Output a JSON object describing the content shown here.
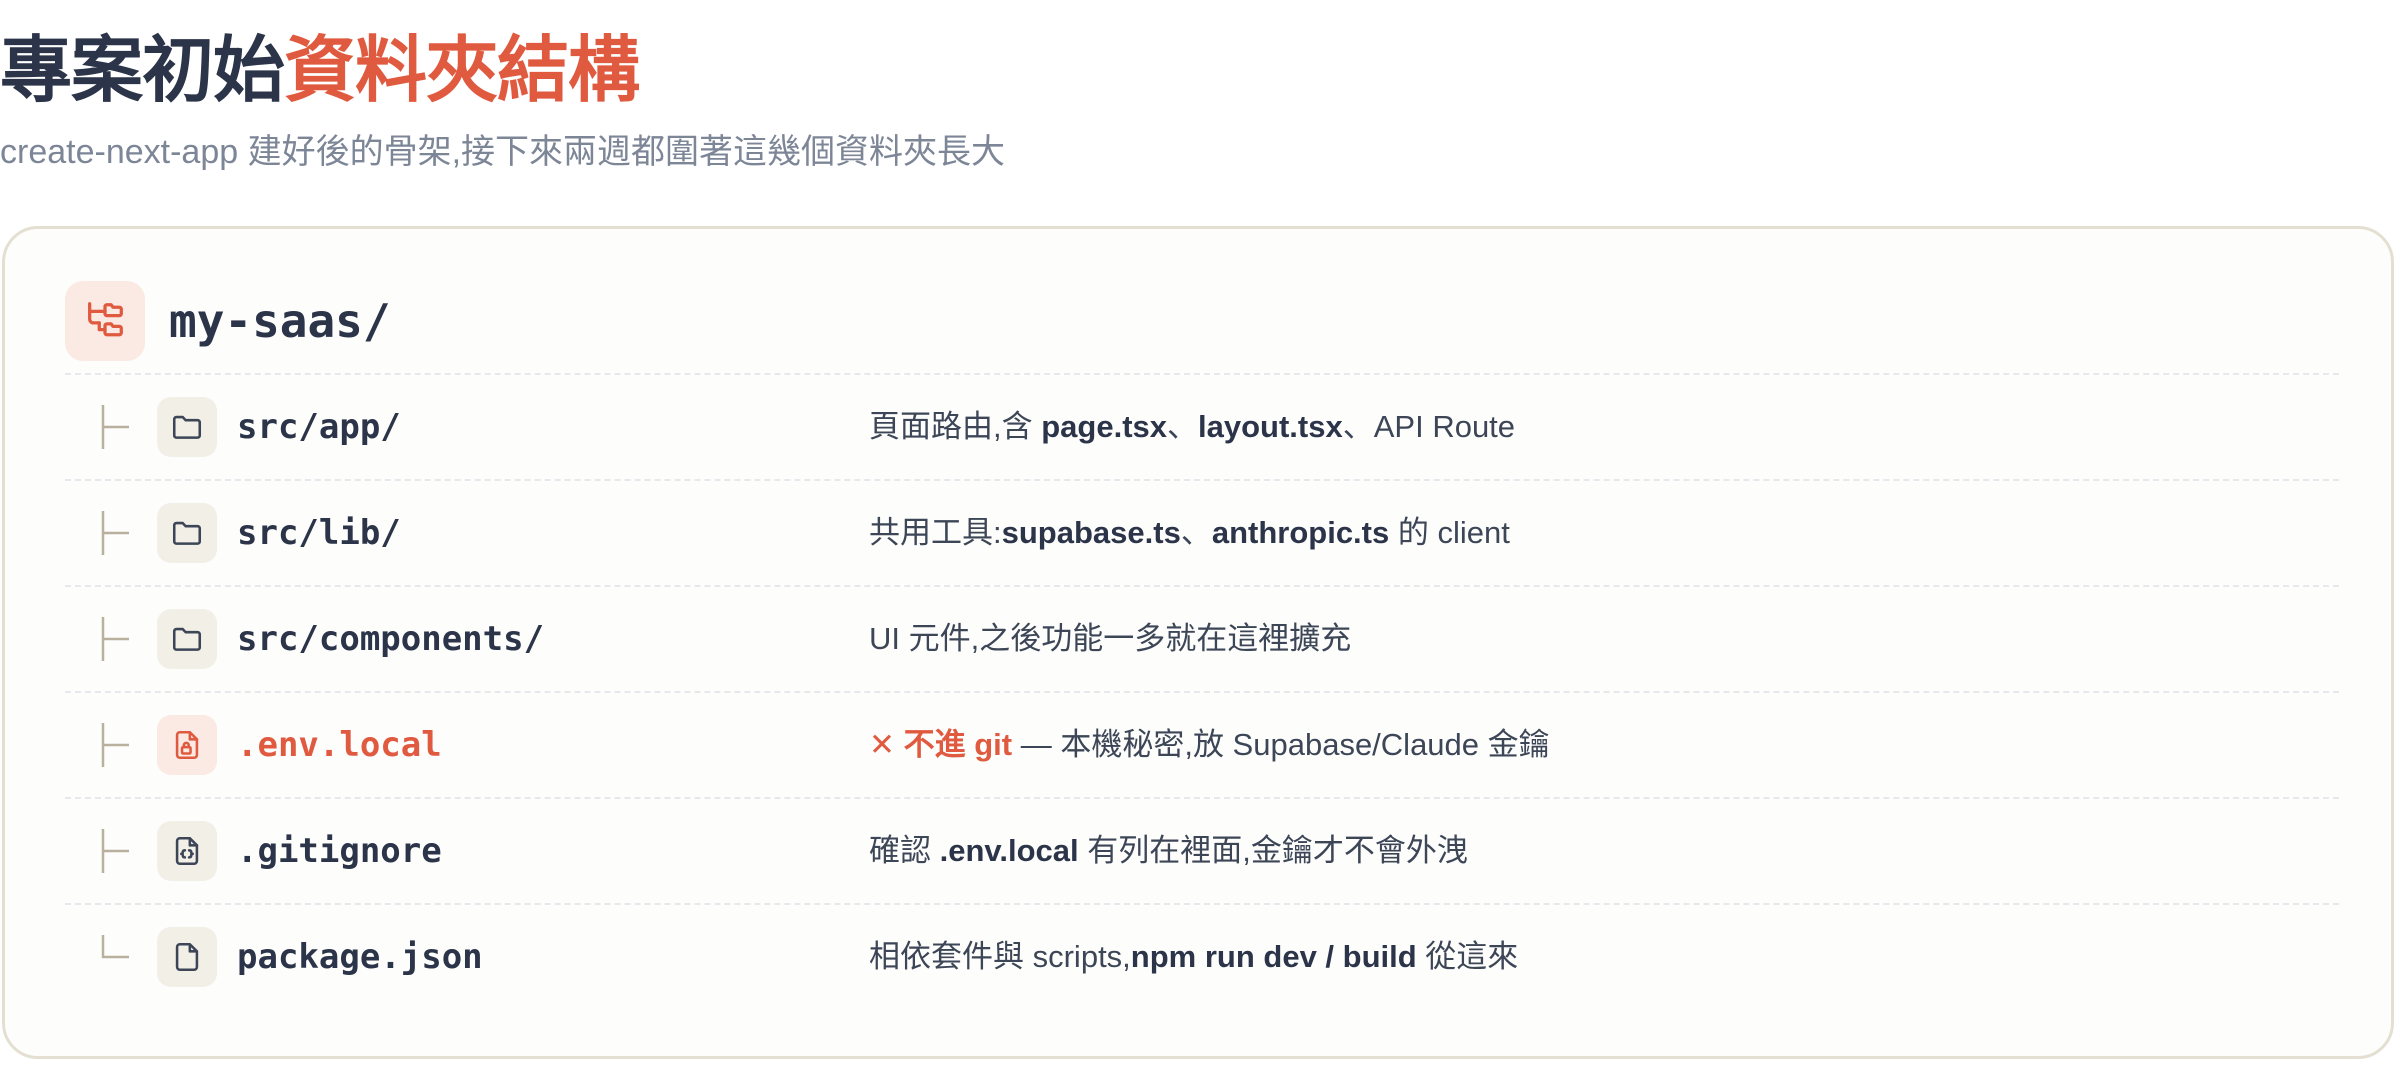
{
  "heading": {
    "title_main": "專案初始",
    "title_accent": "資料夾結構",
    "subtitle": "create-next-app 建好後的骨架,接下來兩週都圍著這幾個資料夾長大"
  },
  "colors": {
    "accent": "#e05a40",
    "text_dark": "#2b3448",
    "text_muted": "#7d8697",
    "card_border": "#e3e0d2",
    "icon_bg": "#f2efe7",
    "icon_bg_danger": "#fbe9e3"
  },
  "tree": {
    "root": {
      "name": "my-saas/",
      "icon": "folder-tree-icon"
    },
    "items": [
      {
        "name": "src/app/",
        "icon": "folder-icon",
        "connector": "├",
        "desc": {
          "p1": "頁面路由,含 ",
          "b1": "page.tsx",
          "p2": "、",
          "b2": "layout.tsx",
          "p3": "、API Route"
        }
      },
      {
        "name": "src/lib/",
        "icon": "folder-icon",
        "connector": "├",
        "desc": {
          "p1": "共用工具:",
          "b1": "supabase.ts",
          "p2": "、",
          "b2": "anthropic.ts",
          "p3": " 的 client"
        }
      },
      {
        "name": "src/components/",
        "icon": "folder-icon",
        "connector": "├",
        "desc": {
          "p1": "UI 元件,之後功能一多就在這裡擴充"
        }
      },
      {
        "name": ".env.local",
        "icon": "lock-file-icon",
        "connector": "├",
        "danger": true,
        "desc": {
          "warn_mark": "✕",
          "warn_text": "不進 git",
          "p1": " — 本機秘密,放 Supabase/Claude 金鑰"
        }
      },
      {
        "name": ".gitignore",
        "icon": "code-file-icon",
        "connector": "├",
        "desc": {
          "p1": "確認 ",
          "b1": ".env.local",
          "p2": " 有列在裡面,金鑰才不會外洩"
        }
      },
      {
        "name": "package.json",
        "icon": "file-icon",
        "connector": "└",
        "desc": {
          "p1": "相依套件與 scripts,",
          "b1": "npm run dev / build",
          "p2": " 從這來"
        }
      }
    ]
  }
}
